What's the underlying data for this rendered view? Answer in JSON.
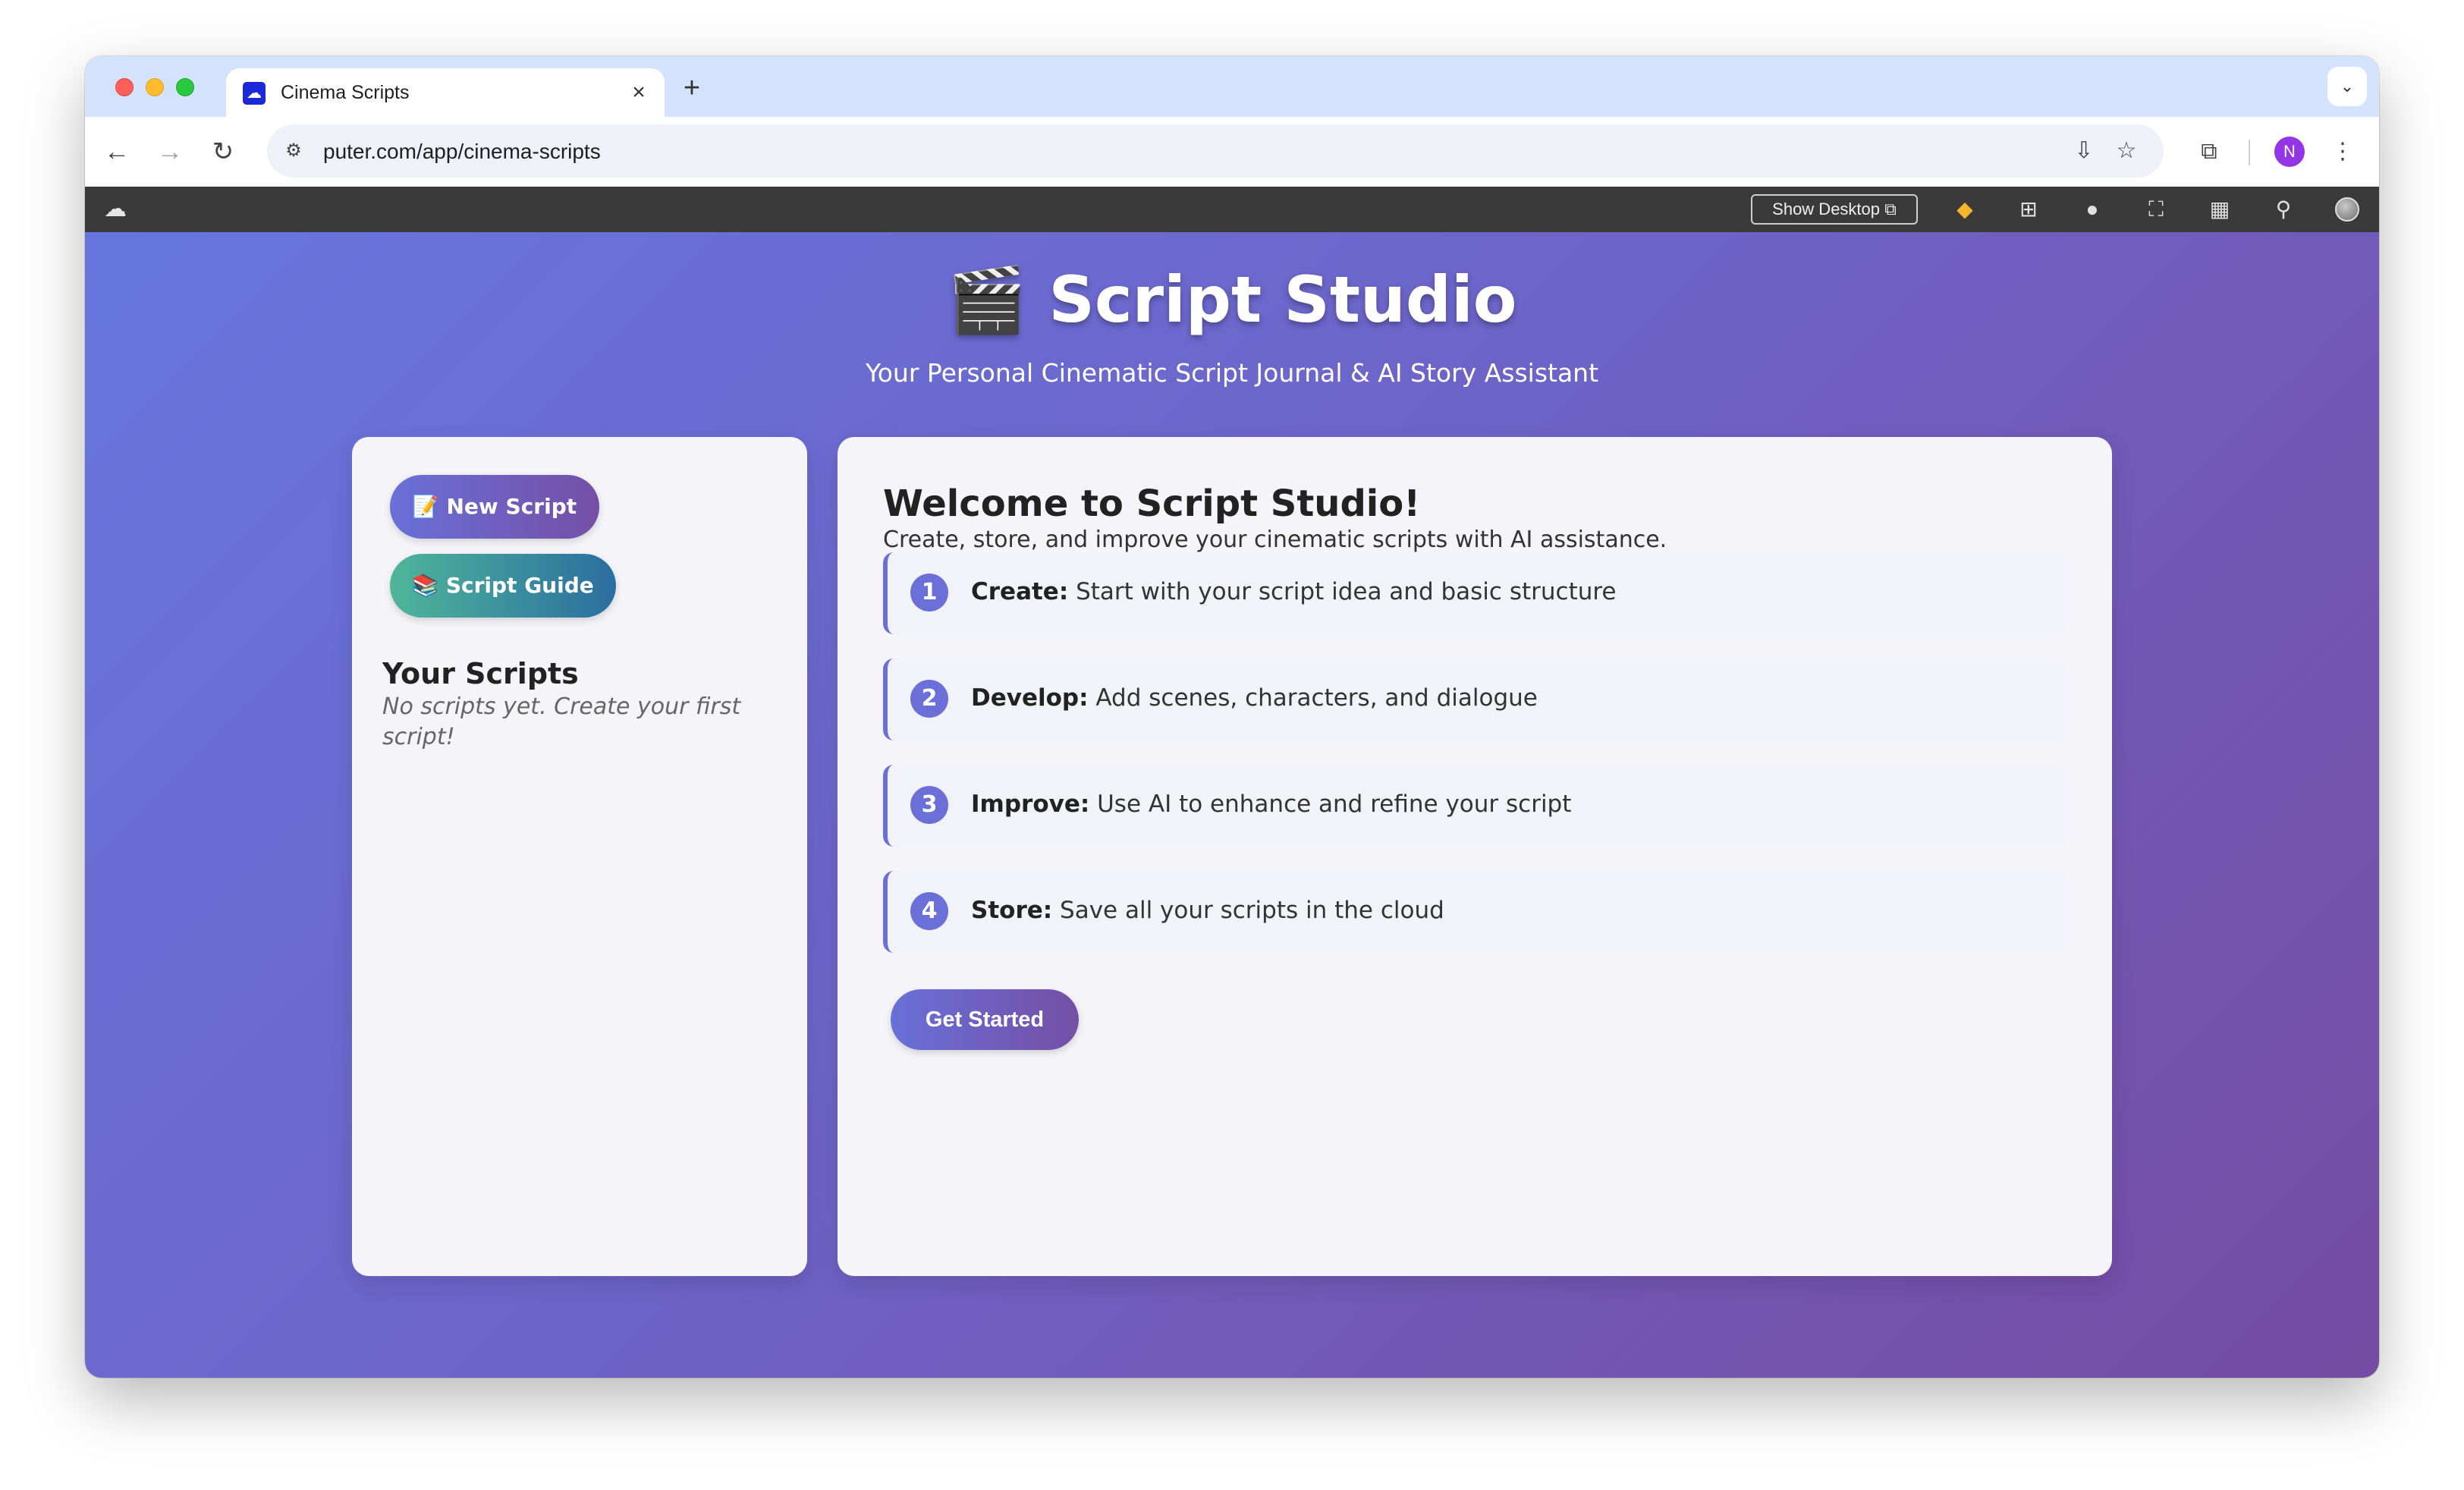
{
  "browser": {
    "tab_title": "Cinema Scripts",
    "tab_close": "×",
    "new_tab": "+",
    "tab_menu": "⌄",
    "url": "puter.com/app/cinema-scripts",
    "profile_initial": "N"
  },
  "puter_bar": {
    "show_desktop_label": "Show Desktop ⧉"
  },
  "header": {
    "title": "🎬 Script Studio",
    "subtitle": "Your Personal Cinematic Script Journal & AI Story Assistant"
  },
  "sidebar": {
    "new_script_label": "📝 New Script",
    "script_guide_label": "📚 Script Guide",
    "scripts_heading": "Your Scripts",
    "empty_message": "No scripts yet. Create your first script!"
  },
  "main": {
    "welcome_title": "Welcome to Script Studio!",
    "welcome_desc": "Create, store, and improve your cinematic scripts with AI assistance.",
    "steps": [
      {
        "num": "1",
        "label": "Create:",
        "text": "Start with your script idea and basic structure"
      },
      {
        "num": "2",
        "label": "Develop:",
        "text": "Add scenes, characters, and dialogue"
      },
      {
        "num": "3",
        "label": "Improve:",
        "text": "Use AI to enhance and refine your script"
      },
      {
        "num": "4",
        "label": "Store:",
        "text": "Save all your scripts in the cloud"
      }
    ],
    "get_started_label": "Get Started"
  },
  "colors": {
    "gradient_start": "#6676de",
    "gradient_end": "#764ba2",
    "accent": "#6a70d8",
    "guide_gradient_start": "#4fb59a",
    "guide_gradient_end": "#2a6ea0"
  }
}
